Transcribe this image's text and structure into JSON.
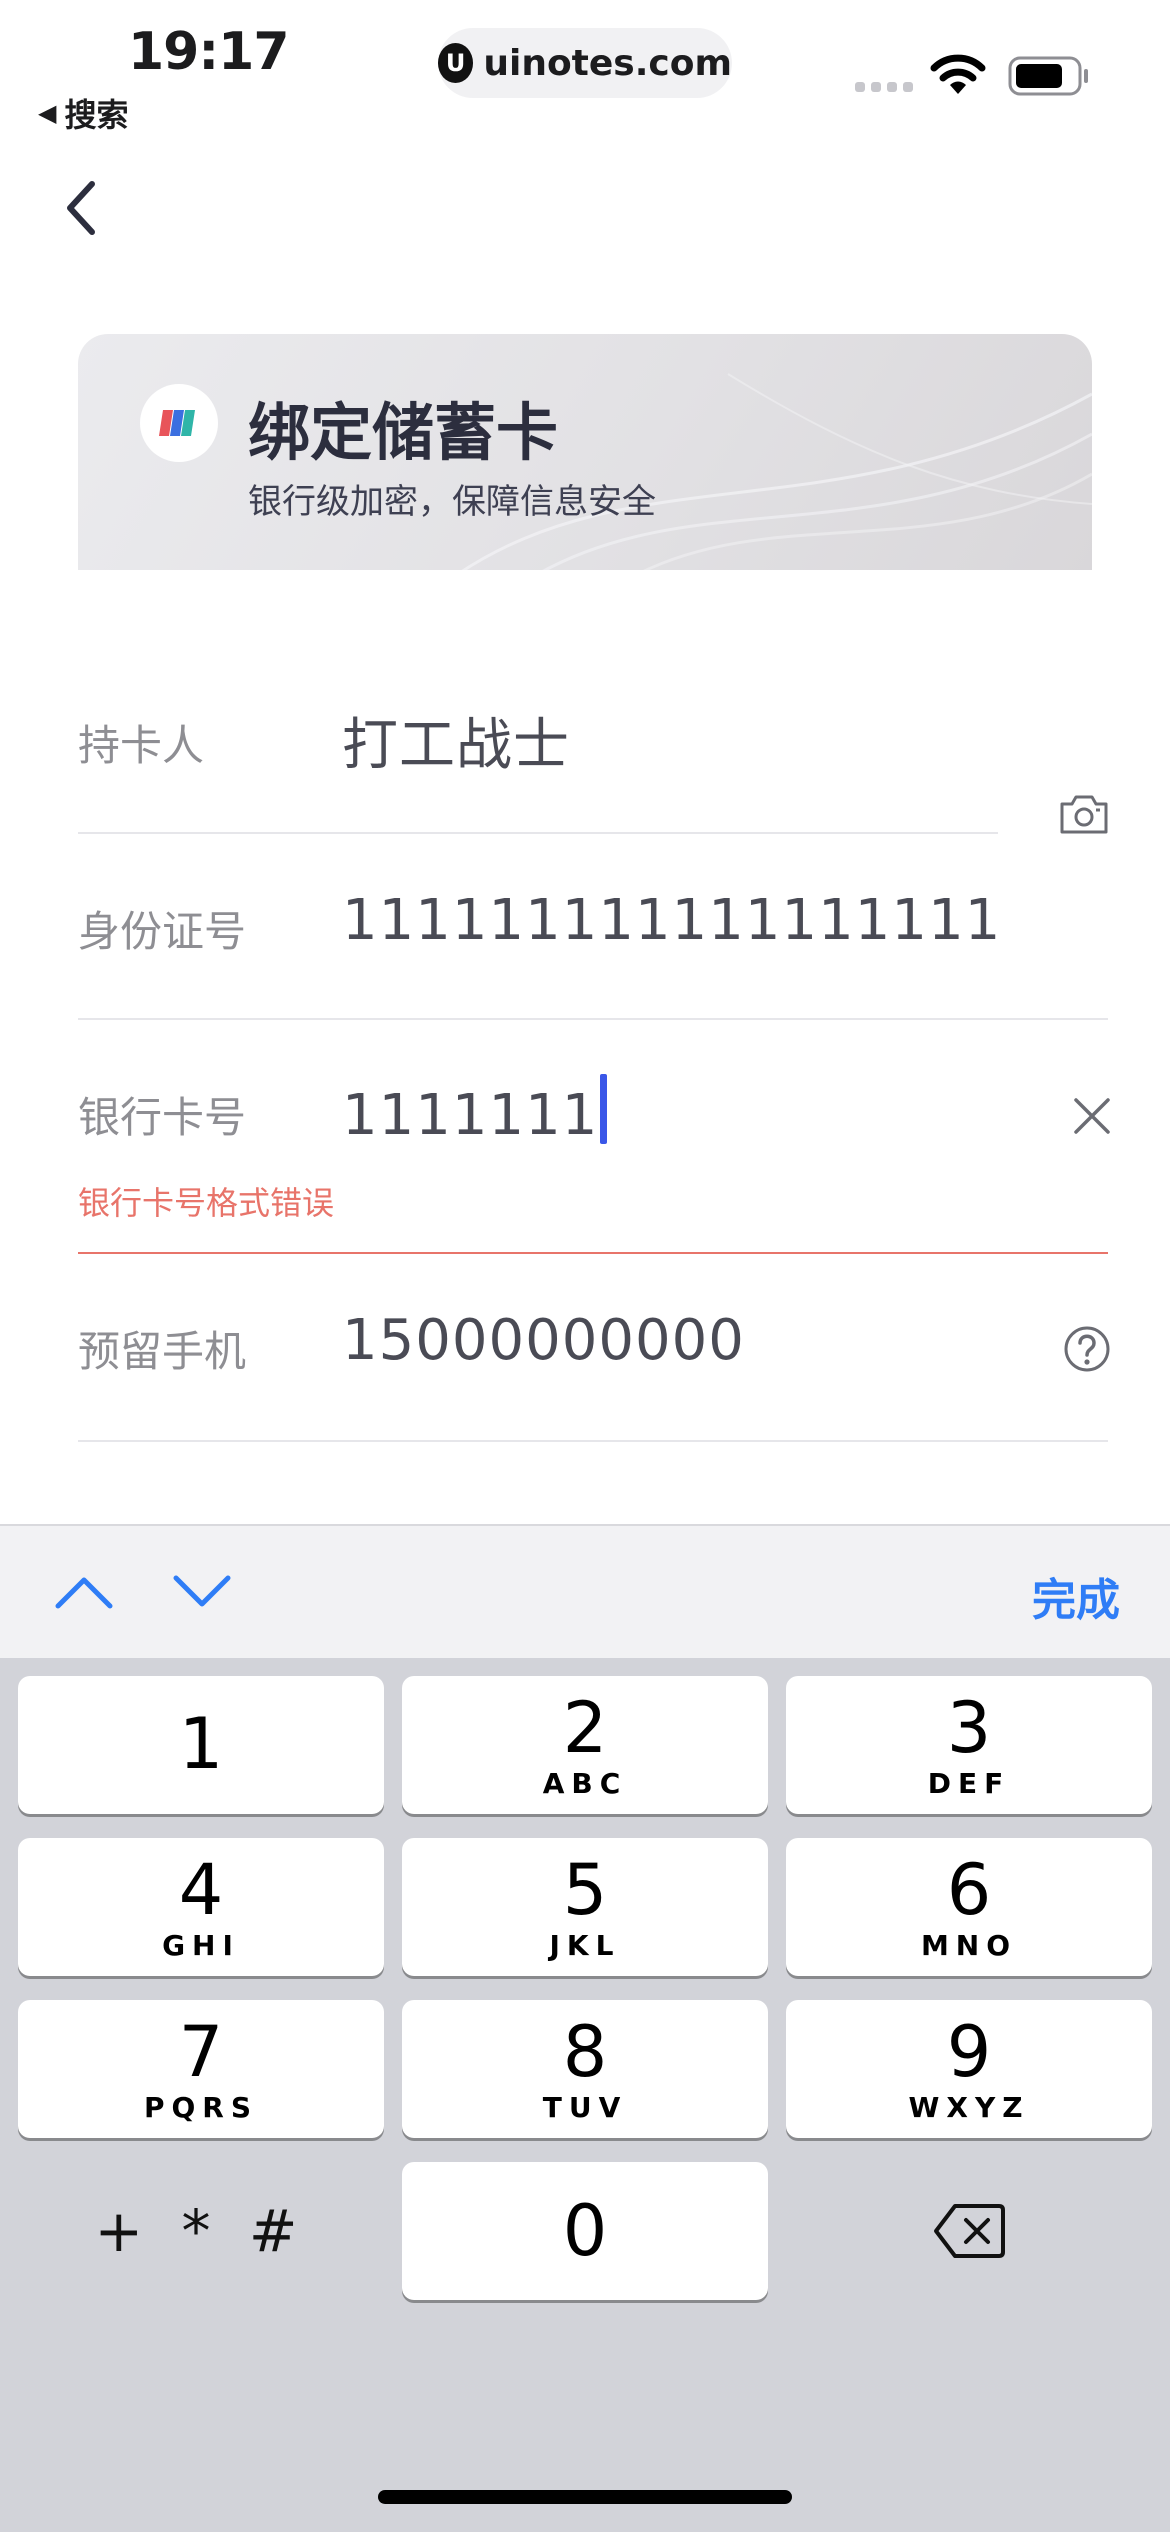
{
  "status_bar": {
    "time": "19:17",
    "back_app": "搜索",
    "url": "uinotes.com"
  },
  "card": {
    "title": "绑定储蓄卡",
    "subtitle": "银行级加密，保障信息安全"
  },
  "form": {
    "rows": [
      {
        "label": "持卡人",
        "value": "打工战士"
      },
      {
        "label": "身份证号",
        "value": "111111111111111111"
      },
      {
        "label": "银行卡号",
        "value": "1111111"
      },
      {
        "label": "预留手机",
        "value": "15000000000"
      }
    ],
    "bank_card_error": "银行卡号格式错误",
    "colors": {
      "error": "#e8746a",
      "caret": "#3a57e8"
    }
  },
  "keyboard": {
    "done_label": "完成",
    "accent_color": "#2f7df6",
    "keys": [
      {
        "num": "1",
        "letters": ""
      },
      {
        "num": "2",
        "letters": "ABC"
      },
      {
        "num": "3",
        "letters": "DEF"
      },
      {
        "num": "4",
        "letters": "GHI"
      },
      {
        "num": "5",
        "letters": "JKL"
      },
      {
        "num": "6",
        "letters": "MNO"
      },
      {
        "num": "7",
        "letters": "PQRS"
      },
      {
        "num": "8",
        "letters": "TUV"
      },
      {
        "num": "9",
        "letters": "WXYZ"
      },
      {
        "num": "0",
        "letters": ""
      }
    ],
    "symbols_key": "+ * #",
    "icons": [
      "chevron-up-icon",
      "chevron-down-icon",
      "backspace-icon"
    ]
  }
}
